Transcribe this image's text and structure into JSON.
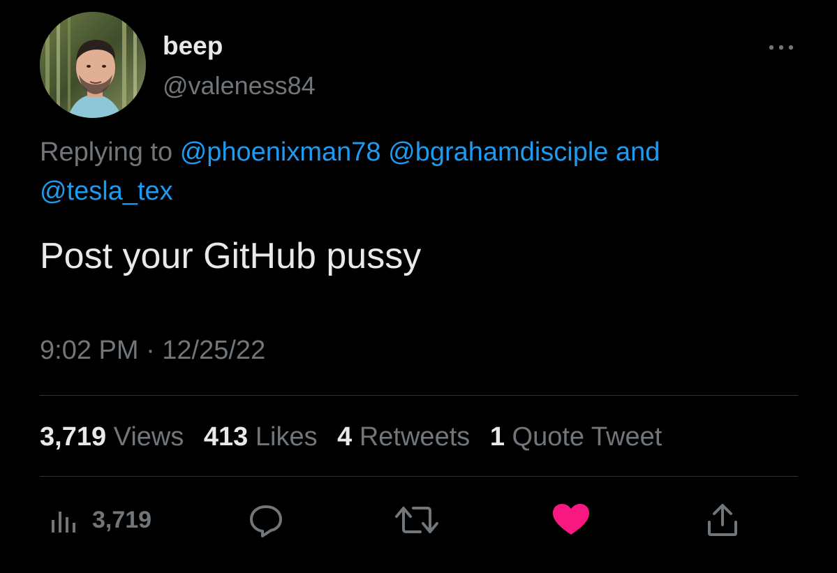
{
  "user": {
    "display_name": "beep",
    "handle": "@valeness84",
    "avatar_icon": "avatar-photo"
  },
  "menu": {
    "icon": "more-horizontal-icon"
  },
  "reply_context": {
    "prefix": "Replying to",
    "mentions": [
      "@phoenixman78",
      "@bgrahamdisciple",
      "@tesla_tex"
    ],
    "conjunction": "and"
  },
  "tweet": {
    "text": "Post your GitHub pussy",
    "timestamp": "9:02 PM · 12/25/22"
  },
  "stats": {
    "views_count": "3,719",
    "views_label": "Views",
    "likes_count": "413",
    "likes_label": "Likes",
    "retweets_count": "4",
    "retweets_label": "Retweets",
    "quotes_count": "1",
    "quotes_label": "Quote Tweet"
  },
  "actions": {
    "analytics_count": "3,719",
    "analytics_icon": "analytics-icon",
    "reply_icon": "reply-icon",
    "retweet_icon": "retweet-icon",
    "like_icon": "heart-icon",
    "share_icon": "share-icon"
  },
  "colors": {
    "background": "#000000",
    "text_primary": "#e7e9ea",
    "text_secondary": "#71767b",
    "accent_blue": "#1d9bf0",
    "like_pink": "#f91880",
    "divider": "#2f3336"
  }
}
